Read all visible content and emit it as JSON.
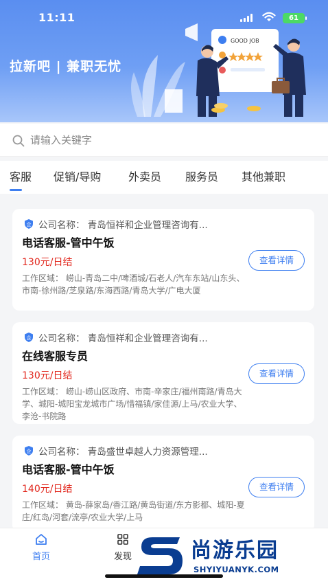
{
  "status_bar": {
    "time": "11:11",
    "battery": "61"
  },
  "hero": {
    "slogan": "拉新吧 | 兼职无忧",
    "illustration_text": "GOOD JOB"
  },
  "search": {
    "placeholder": "请输入关键字"
  },
  "tabs": [
    {
      "label": "客服",
      "active": true
    },
    {
      "label": "促销/导购",
      "active": false
    },
    {
      "label": "外卖员",
      "active": false
    },
    {
      "label": "服务员",
      "active": false
    },
    {
      "label": "其他兼职",
      "active": false
    }
  ],
  "jobs": [
    {
      "company": "公司名称：  青岛恒祥和企业管理咨询有...",
      "title": "电话客服-管中午饭",
      "salary": "130元/日结",
      "area": "工作区域：  崂山-青岛二中/啤酒城/石老人/汽车东站/山东头、市南-徐州路/芝泉路/东海西路/青岛大学/广电大厦",
      "button": "查看详情"
    },
    {
      "company": "公司名称：  青岛恒祥和企业管理咨询有...",
      "title": "在线客服专员",
      "salary": "130元/日结",
      "area": "工作区域：  崂山-崂山区政府、市南-辛家庄/福州南路/青岛大学、城阳-城阳宝龙城市广场/惜福镇/家佳源/上马/农业大学、李沧-书院路",
      "button": "查看详情"
    },
    {
      "company": "公司名称：  青岛盛世卓越人力资源管理...",
      "title": "电话客服-管中午饭",
      "salary": "140元/日结",
      "area": "工作区域：  黄岛-薛家岛/香江路/黄岛街道/东方影都、城阳-夏庄/红岛/河套/流亭/农业大学/上马",
      "button": "查看详情"
    }
  ],
  "bottom_nav": [
    {
      "label": "首页",
      "icon": "home-icon",
      "active": true
    },
    {
      "label": "发现",
      "icon": "grid-icon",
      "active": false
    }
  ],
  "watermark": {
    "cn": "尚游乐园",
    "en": "SHYIYUANYK.COM"
  },
  "colors": {
    "accent": "#3d7ef0",
    "salary": "#e1251b",
    "hero_top": "#5a8ef0"
  }
}
